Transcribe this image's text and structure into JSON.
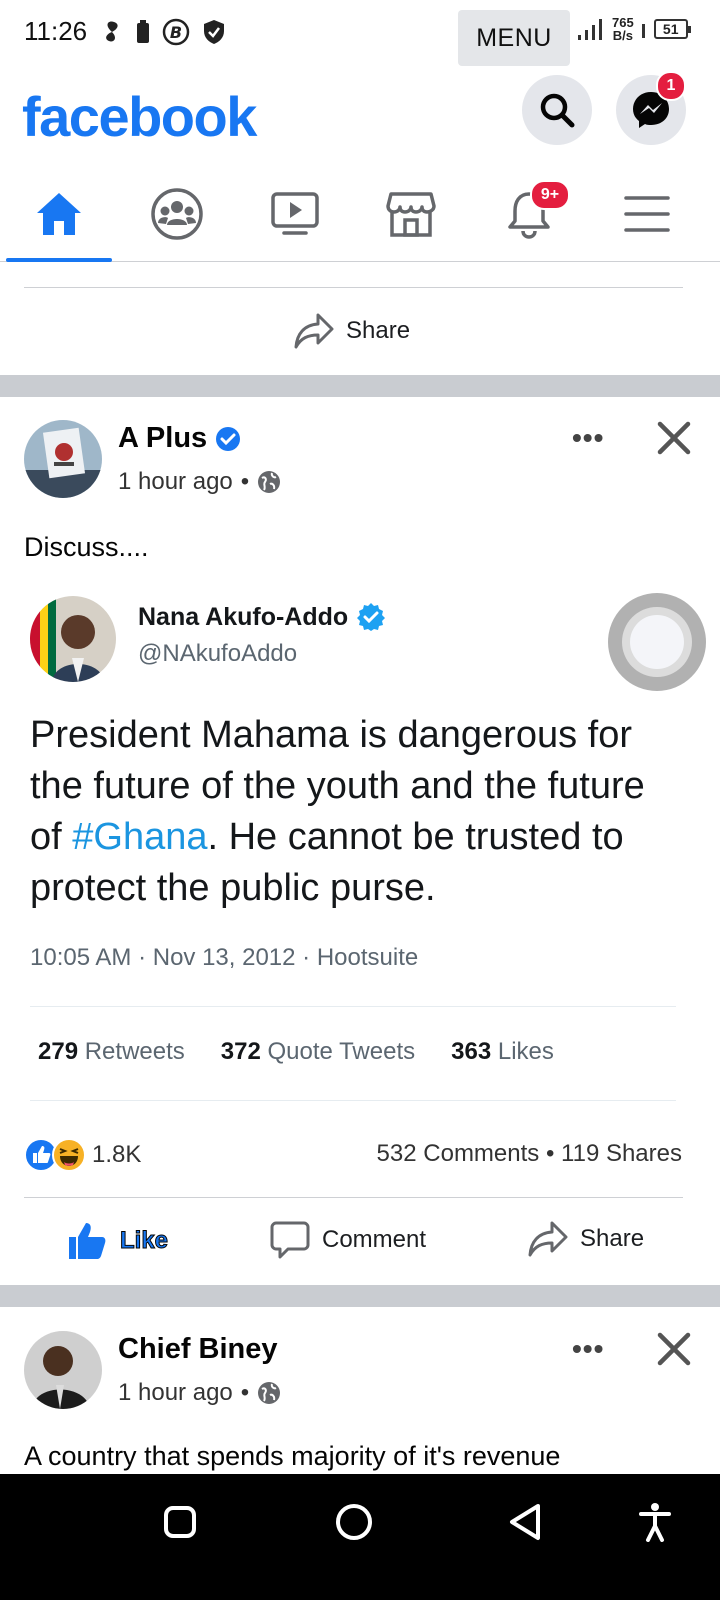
{
  "status_bar": {
    "time": "11:26",
    "menu_label": "MENU",
    "net_speed_value": "765",
    "net_speed_unit": "B/s",
    "battery": "51"
  },
  "header": {
    "logo": "facebook",
    "messenger_badge": "1"
  },
  "nav": {
    "tabs": [
      {
        "name": "home",
        "icon": "home-icon",
        "active": true
      },
      {
        "name": "groups",
        "icon": "groups-icon"
      },
      {
        "name": "watch",
        "icon": "video-icon"
      },
      {
        "name": "marketplace",
        "icon": "store-icon"
      },
      {
        "name": "notifications",
        "icon": "bell-icon",
        "badge": "9+"
      },
      {
        "name": "menu",
        "icon": "hamburger-icon"
      }
    ],
    "accent": "#1877f2"
  },
  "prev_post": {
    "share_label": "Share"
  },
  "post1": {
    "author": "A Plus",
    "time": "1 hour ago",
    "text": "Discuss....",
    "tweet": {
      "name": "Nana Akufo-Addo",
      "handle": "@NAkufoAddo",
      "body_before": "President Mahama is dangerous for the future of the youth and the future of ",
      "hashtag": "#Ghana",
      "body_after": ". He cannot be trusted to protect the public purse.",
      "meta": "10:05 AM · Nov 13, 2012 · Hootsuite",
      "retweets_count": "279",
      "retweets_label": "Retweets",
      "quotes_count": "372",
      "quotes_label": "Quote Tweets",
      "likes_count": "363",
      "likes_label": "Likes"
    },
    "reactions_count": "1.8K",
    "comments_shares": "532 Comments • 119 Shares",
    "actions": {
      "like": "Like",
      "comment": "Comment",
      "share": "Share"
    }
  },
  "post2": {
    "author": "Chief Biney",
    "time": "1 hour ago",
    "text": "A country that spends majority of it's revenue"
  }
}
